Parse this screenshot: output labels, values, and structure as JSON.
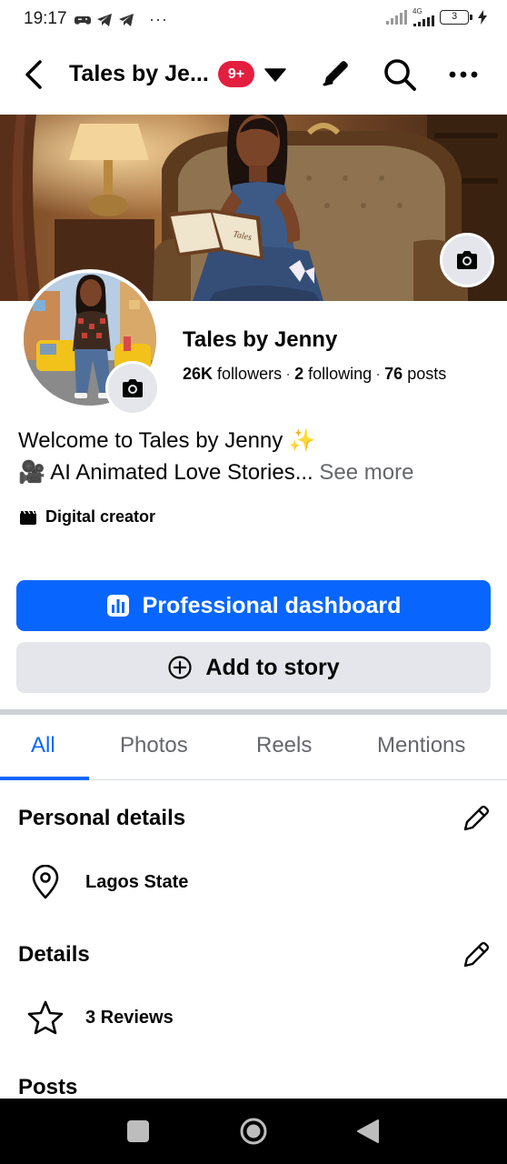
{
  "status_bar": {
    "time": "19:17",
    "dots": "···",
    "network": "4G",
    "battery": "3"
  },
  "header": {
    "title": "Tales by Je...",
    "notification_badge": "9+"
  },
  "profile": {
    "name": "Tales by Jenny",
    "followers_count": "26K",
    "followers_label": "followers",
    "following_count": "2",
    "following_label": "following",
    "posts_count": "76",
    "posts_label": "posts",
    "bio_line1": "Welcome to Tales by Jenny ✨",
    "bio_line2_icon": "🎥",
    "bio_line2": "AI Animated Love Stories",
    "bio_ellipsis": "...",
    "see_more": "See more",
    "category": "Digital creator"
  },
  "actions": {
    "primary_label": "Professional dashboard",
    "secondary_label": "Add to story"
  },
  "tabs": [
    {
      "label": "All",
      "active": true
    },
    {
      "label": "Photos",
      "active": false
    },
    {
      "label": "Reels",
      "active": false
    },
    {
      "label": "Mentions",
      "active": false
    }
  ],
  "sections": {
    "personal_details": {
      "title": "Personal details",
      "location": "Lagos State"
    },
    "details": {
      "title": "Details",
      "reviews": "3 Reviews"
    },
    "posts": {
      "title": "Posts"
    }
  },
  "colors": {
    "accent": "#0866ff",
    "badge": "#e41e3f",
    "secondary_button": "#e4e6eb",
    "muted_text": "#65676b"
  },
  "icons": {
    "back": "chevron-left-icon",
    "dropdown": "caret-down-icon",
    "edit": "pencil-icon",
    "search": "search-icon",
    "more": "more-dots-icon",
    "camera": "camera-icon",
    "dashboard": "bar-chart-icon",
    "add_story": "plus-circle-icon",
    "location": "location-pin-icon",
    "reviews": "star-icon",
    "category": "clapperboard-icon"
  }
}
